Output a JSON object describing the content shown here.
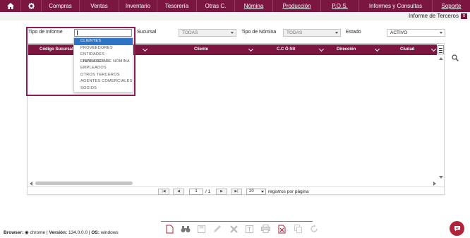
{
  "menu": {
    "items": [
      "Compras",
      "Ventas",
      "Inventario",
      "Tesorería",
      "Otras C.",
      "Nómina",
      "Producción",
      "P.O.S.",
      "Informes y Consultas",
      "Soporte"
    ],
    "home_icon": "home-icon",
    "settings_icon": "gear-icon"
  },
  "header": {
    "title": "Informe de Terceros",
    "close_label": "x"
  },
  "filters": {
    "tipo_label": "Tipo de Informe",
    "tipo_value": "",
    "sucursal_label": "Sucursal",
    "sucursal_value": "TODAS",
    "nomina_label": "Tipo de Nómina",
    "nomina_value": "TODAS",
    "estado_label": "Estado",
    "estado_value": "ACTIVO"
  },
  "dropdown": {
    "options": [
      "CLIENTES",
      "PROVEEDORES",
      "ENTIDADES FINANCIERAS",
      "ENTIDADES DE NÓMINA",
      "EMPLEADOS",
      "OTROS TERCEROS",
      "AGENTES COMERCIALES",
      "SOCIOS"
    ],
    "selected": "CLIENTES"
  },
  "table": {
    "columns": [
      "Código Sucursal",
      "",
      "Cliente",
      "C.C Ó Nit",
      "Dirección",
      "Ciudad"
    ]
  },
  "pager": {
    "first": "|◀",
    "prev": "◀",
    "page": "1",
    "of": "/ 1",
    "next": "▶",
    "last": "▶|",
    "page_size": "20",
    "page_size_label": "registros por página"
  },
  "footer": {
    "browser_label": "Browser:",
    "browser": "chrome",
    "version_label": "Versión:",
    "version": "134.0.0.0",
    "os_label": "OS:",
    "os": "windows"
  },
  "colors": {
    "brand": "#7a1640",
    "highlight": "#8a1d56",
    "selection": "#2f73c5",
    "chat": "#b0233a"
  }
}
